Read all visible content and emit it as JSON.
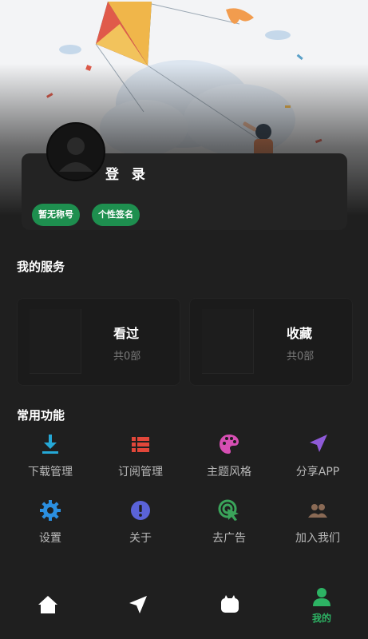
{
  "profile": {
    "login_label": "登 录",
    "tags": [
      "暂无称号",
      "个性签名"
    ]
  },
  "services": {
    "title": "我的服务",
    "items": [
      {
        "title": "看过",
        "count": "共0部"
      },
      {
        "title": "收藏",
        "count": "共0部"
      }
    ]
  },
  "features": {
    "title": "常用功能",
    "items": [
      {
        "label": "下载管理",
        "icon": "download-icon",
        "color": "#25a8d6"
      },
      {
        "label": "订阅管理",
        "icon": "list-icon",
        "color": "#e2473a"
      },
      {
        "label": "主题风格",
        "icon": "palette-icon",
        "color": "#d64fb3"
      },
      {
        "label": "分享APP",
        "icon": "send-icon",
        "color": "#8e5ad8"
      },
      {
        "label": "设置",
        "icon": "gear-icon",
        "color": "#2b8fe0"
      },
      {
        "label": "关于",
        "icon": "info-icon",
        "color": "#5a63d8"
      },
      {
        "label": "去广告",
        "icon": "cursor-click-icon",
        "color": "#3aa45a"
      },
      {
        "label": "加入我们",
        "icon": "group-icon",
        "color": "#8a6a55"
      }
    ]
  },
  "nav": {
    "items": [
      {
        "icon": "home-icon"
      },
      {
        "icon": "send-icon"
      },
      {
        "icon": "tv-icon"
      },
      {
        "icon": "person-icon",
        "label": "我的",
        "active_color": "#2db364"
      }
    ]
  }
}
